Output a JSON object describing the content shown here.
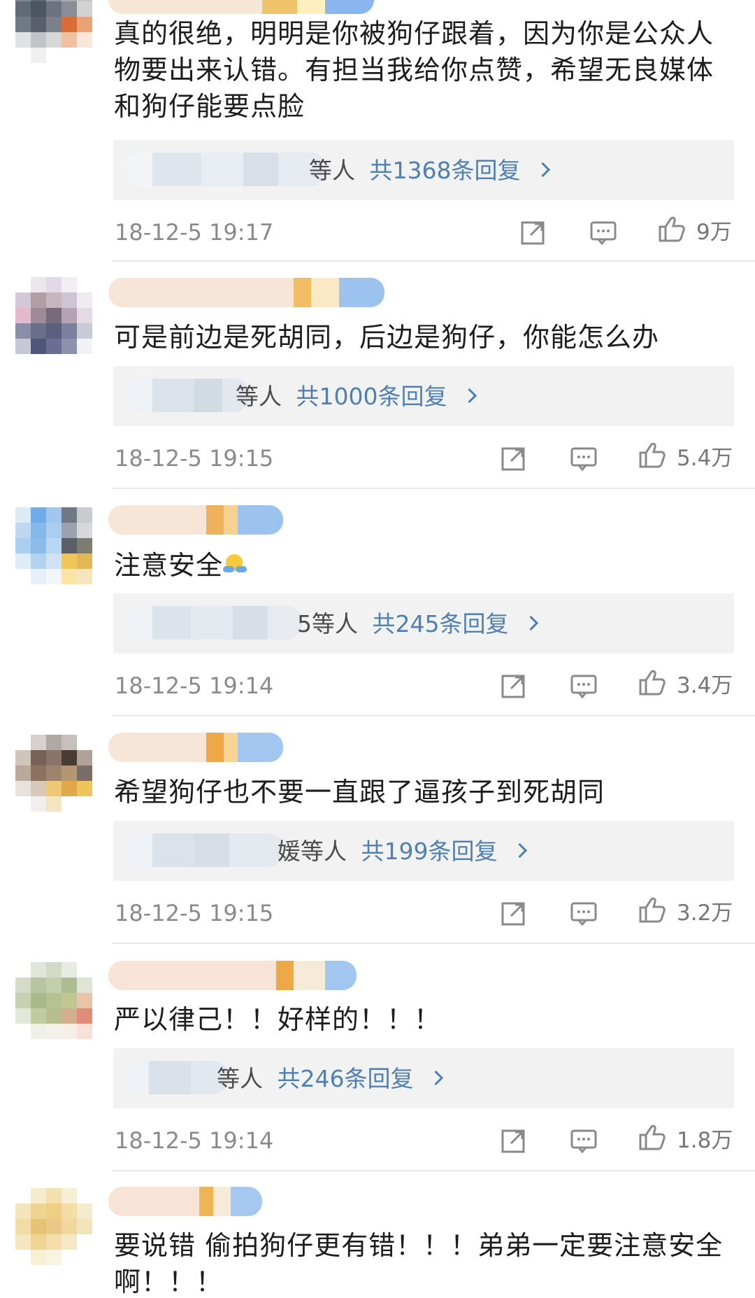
{
  "comments": [
    {
      "text": "真的很绝，明明是你被狗仔跟着，因为你是公众人物要出来认错。有担当我给你点赞，希望无良媒体和狗仔能要点脸",
      "reply_suffix": "等人",
      "reply_count": "共1368条回复",
      "timestamp": "18-12-5 19:17",
      "likes": "9万"
    },
    {
      "text": "可是前边是死胡同，后边是狗仔，你能怎么办",
      "reply_suffix": "等人",
      "reply_count": "共1000条回复",
      "timestamp": "18-12-5 19:15",
      "likes": "5.4万"
    },
    {
      "text": "注意安全",
      "reply_suffix": "5等人",
      "reply_count": "共245条回复",
      "timestamp": "18-12-5 19:14",
      "likes": "3.4万"
    },
    {
      "text": "希望狗仔也不要一直跟了逼孩子到死胡同",
      "reply_suffix": "媛等人",
      "reply_count": "共199条回复",
      "timestamp": "18-12-5 19:15",
      "likes": "3.2万"
    },
    {
      "text": "严以律己！！好样的！！！",
      "reply_suffix": "等人",
      "reply_count": "共246条回复",
      "timestamp": "18-12-5 19:14",
      "likes": "1.8万"
    },
    {
      "text": "要说错 偷拍狗仔更有错！！！弟弟一定要注意安全啊！！！"
    }
  ],
  "icons": {
    "share": "share-icon",
    "comment": "comment-icon",
    "like": "like-icon",
    "emoji": "emoji-icon"
  },
  "colors": {
    "reply_link": "#4f7fb3",
    "reply_bg": "#f2f2f2",
    "timestamp": "#8a8a8a",
    "divider": "#e8e8e8"
  }
}
